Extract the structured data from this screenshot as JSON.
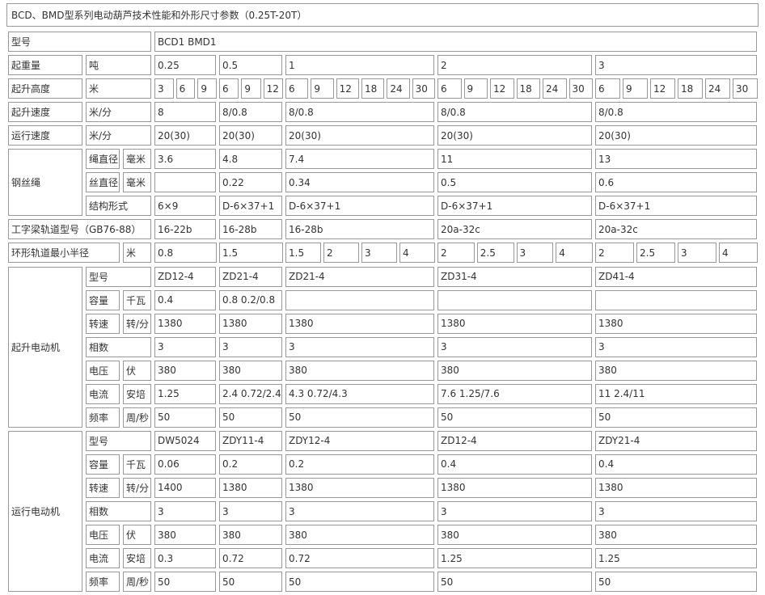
{
  "title": "BCD、BMD型系列电动葫芦技术性能和外形尺寸参数（0.25T-20T）",
  "header": {
    "label": "型号",
    "models": "BCD1                    BMD1"
  },
  "rows": {
    "capacity": {
      "label": "起重量",
      "unit": "吨",
      "vals": [
        "0.25",
        "0.5",
        "1",
        "2",
        "3"
      ]
    },
    "height": {
      "label": "起升高度",
      "unit": "米",
      "vals": [
        [
          "3",
          "6",
          "9"
        ],
        [
          "6",
          "9",
          "12"
        ],
        [
          "6",
          "9",
          "12",
          "18",
          "24",
          "30"
        ],
        [
          "6",
          "9",
          "12",
          "18",
          "24",
          "30"
        ],
        [
          "6",
          "9",
          "12",
          "18",
          "24",
          "30"
        ]
      ]
    },
    "lift_speed": {
      "label": "起升速度",
      "unit": "米/分",
      "vals": [
        "8",
        "8/0.8",
        "8/0.8",
        "8/0.8",
        "8/0.8"
      ]
    },
    "run_speed": {
      "label": "运行速度",
      "unit": "米/分",
      "vals": [
        "20(30)",
        "20(30)",
        "20(30)",
        "20(30)",
        "20(30)"
      ]
    },
    "rope": {
      "label": "钢丝绳",
      "rope_dia": {
        "label": "绳直径",
        "unit": "毫米",
        "vals": [
          "3.6",
          "4.8",
          "7.4",
          "11",
          "13"
        ]
      },
      "wire_dia": {
        "label": "丝直径",
        "unit": "毫米",
        "vals": [
          "",
          "0.22",
          "0.34",
          "0.5",
          "0.6"
        ]
      },
      "struct": {
        "label": "结构形式",
        "vals": [
          "6×9",
          "D-6×37+1",
          "D-6×37+1",
          "D-6×37+1",
          "D-6×37+1"
        ]
      }
    },
    "beam": {
      "label": "工字梁轨道型号（GB76-88）",
      "vals": [
        "16-22b",
        "16-28b",
        "16-28b",
        "20a-32c",
        "20a-32c"
      ]
    },
    "radius": {
      "label": "环形轨道最小半径",
      "unit": "米",
      "vals": [
        [
          "0.8"
        ],
        [
          "1.5"
        ],
        [
          "1.5",
          "2",
          "3",
          "4"
        ],
        [
          "2",
          "2.5",
          "3",
          "4"
        ],
        [
          "2",
          "2.5",
          "3",
          "4"
        ]
      ]
    },
    "lift_motor": {
      "label": "起升电动机",
      "rows": [
        {
          "label": "型号",
          "unit": "",
          "vals": [
            "ZD12-4",
            "ZD21-4",
            "ZD21-4",
            "ZD31-4",
            "ZD41-4"
          ]
        },
        {
          "label": "容量",
          "unit": "千瓦",
          "vals": [
            "0.4",
            "0.8 0.2/0.8",
            "",
            "",
            ""
          ]
        },
        {
          "label": "转速",
          "unit": "转/分",
          "vals": [
            "1380",
            "1380",
            "1380",
            "1380",
            "1380"
          ]
        },
        {
          "label": "相数",
          "unit": "",
          "vals": [
            "3",
            "3",
            "3",
            "3",
            "3"
          ]
        },
        {
          "label": "电压",
          "unit": "伏",
          "vals": [
            "380",
            "380",
            "380",
            "380",
            "380"
          ]
        },
        {
          "label": "电流",
          "unit": "安培",
          "vals": [
            "1.25",
            "2.4 0.72/2.4",
            "4.3 0.72/4.3",
            "7.6 1.25/7.6",
            "11 2.4/11"
          ]
        },
        {
          "label": "频率",
          "unit": "周/秒",
          "vals": [
            "50",
            "50",
            "50",
            "50",
            "50"
          ]
        }
      ]
    },
    "run_motor": {
      "label": "运行电动机",
      "rows": [
        {
          "label": "型号",
          "unit": "",
          "vals": [
            "DW5024",
            "ZDY11-4",
            "ZDY12-4",
            "ZD12-4",
            "ZDY21-4"
          ]
        },
        {
          "label": "容量",
          "unit": "千瓦",
          "vals": [
            "0.06",
            "0.2",
            "0.2",
            "0.4",
            "0.4"
          ]
        },
        {
          "label": "转速",
          "unit": "转/分",
          "vals": [
            "1400",
            "1380",
            "1380",
            "1380",
            "1380"
          ]
        },
        {
          "label": "相数",
          "unit": "",
          "vals": [
            "3",
            "3",
            "3",
            "3",
            "3"
          ]
        },
        {
          "label": "电压",
          "unit": "伏",
          "vals": [
            "380",
            "380",
            "380",
            "380",
            "380"
          ]
        },
        {
          "label": "电流",
          "unit": "安培",
          "vals": [
            "0.3",
            "0.72",
            "0.72",
            "1.25",
            "1.25"
          ]
        },
        {
          "label": "频率",
          "unit": "周/秒",
          "vals": [
            "50",
            "50",
            "50",
            "50",
            "50"
          ]
        }
      ]
    }
  }
}
